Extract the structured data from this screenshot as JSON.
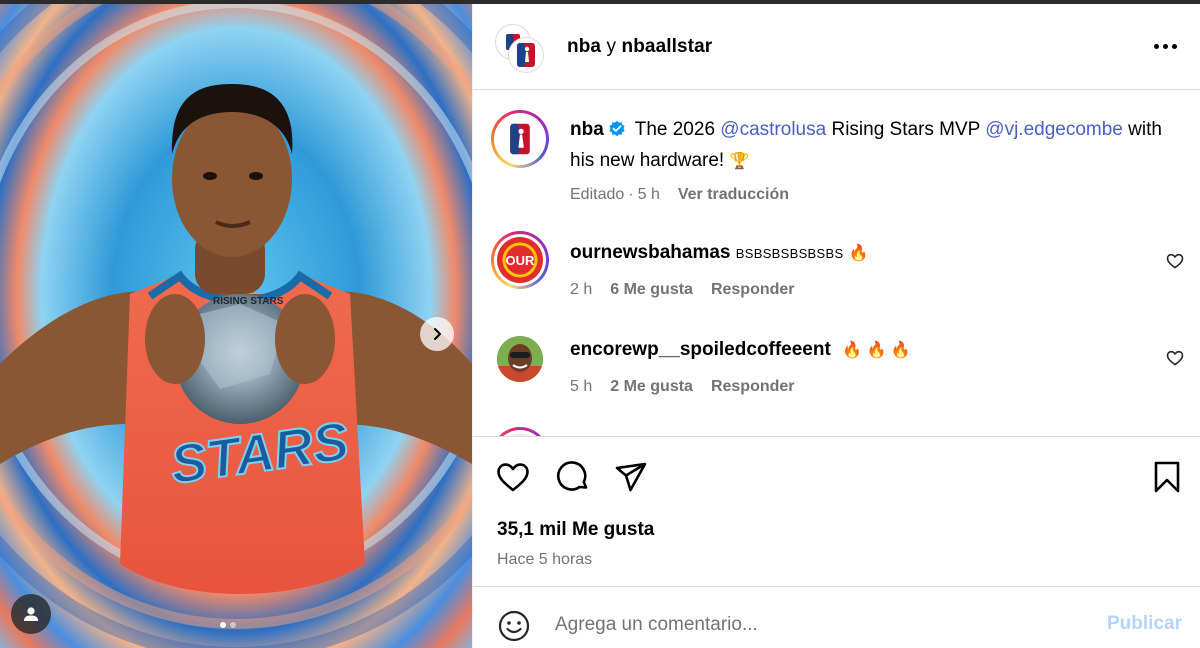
{
  "media": {
    "jersey_text": "STARS",
    "ball_text": "RISING STARS",
    "carousel_count": 2,
    "carousel_active_index": 0
  },
  "header": {
    "account_a": "nba",
    "joiner": "y",
    "account_b": "nbaallstar",
    "avatar_logo_text": "NBA"
  },
  "caption": {
    "username": "nba",
    "text_1": "The 2026",
    "mention_1": "@castrolusa",
    "text_2": "Rising Stars MVP",
    "mention_2": "@vj.edgecombe",
    "text_3": "with his new hardware!",
    "emoji": "🏆",
    "edited": "Editado",
    "separator": "·",
    "time": "5 h",
    "translate": "Ver traducción"
  },
  "comments": [
    {
      "username": "ournewsbahamas",
      "text": "BSBSBSBSBSBS",
      "emoji": "🔥",
      "avatar_text": "OUR",
      "time": "2 h",
      "likes": "6 Me gusta",
      "reply": "Responder"
    },
    {
      "username": "encorewp__spoiledcoffeeent",
      "text": "",
      "emoji": "🔥 🔥 🔥",
      "time": "5 h",
      "likes": "2 Me gusta",
      "reply": "Responder"
    }
  ],
  "stats": {
    "likes": "35,1 mil Me gusta",
    "time_ago": "Hace 5 horas"
  },
  "comment_box": {
    "placeholder": "Agrega un comentario...",
    "publish": "Publicar"
  },
  "colors": {
    "link": "#4a5fc1",
    "muted": "#737373",
    "publish_disabled": "#b3d4fc",
    "verified": "#0095f6"
  },
  "icons": [
    "chevron-right-icon",
    "user-tag-icon",
    "more-icon",
    "verified-icon",
    "heart-icon",
    "comment-icon",
    "share-icon",
    "bookmark-icon",
    "emoji-icon"
  ]
}
